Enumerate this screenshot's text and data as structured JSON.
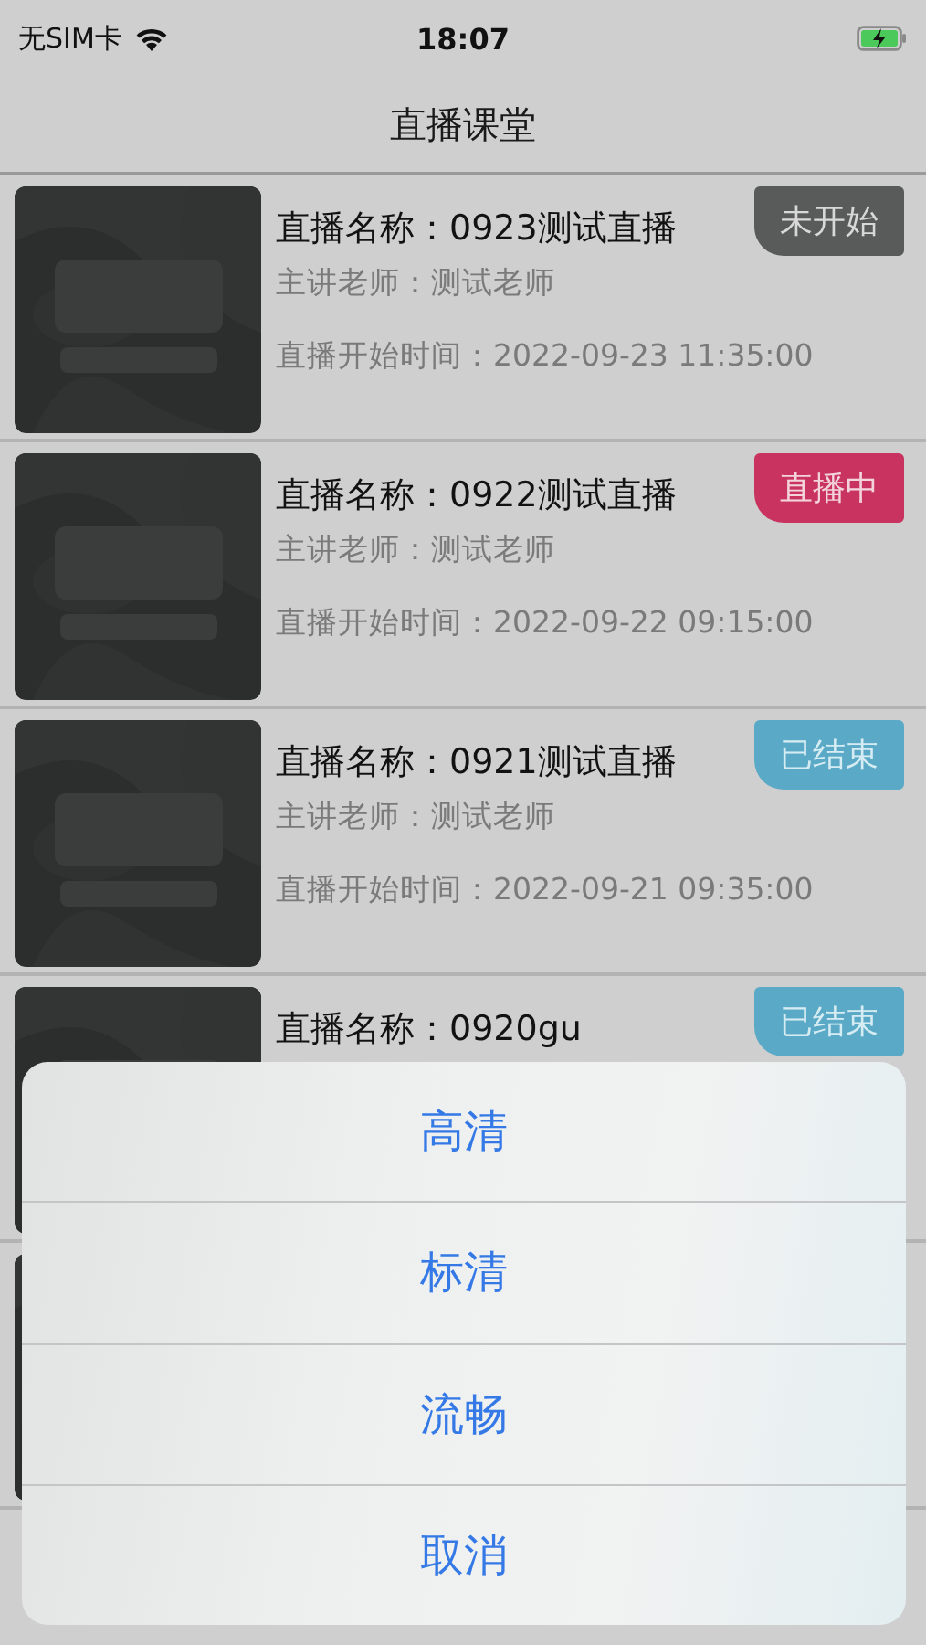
{
  "status_bar": {
    "carrier": "无SIM卡",
    "time": "18:07"
  },
  "nav": {
    "title": "直播课堂"
  },
  "lessons": [
    {
      "kind": "picture",
      "title": "直播名称：0923测试直播",
      "teacher": "主讲老师：测试老师",
      "start_time": "直播开始时间：2022-09-23 11:35:00",
      "status": {
        "kind": "not_started",
        "label": "未开始"
      }
    },
    {
      "kind": "picture",
      "title": "直播名称：0922测试直播",
      "teacher": "主讲老师：测试老师",
      "start_time": "直播开始时间：2022-09-22 09:15:00",
      "status": {
        "kind": "live",
        "label": "直播中"
      }
    },
    {
      "kind": "picture",
      "title": "直播名称：0921测试直播",
      "teacher": "主讲老师：测试老师",
      "start_time": "直播开始时间：2022-09-21 09:35:00",
      "status": {
        "kind": "ended",
        "label": "已结束"
      }
    },
    {
      "kind": "picture",
      "title": "直播名称：0920gu",
      "status": {
        "kind": "ended",
        "label": "已结束"
      }
    },
    {
      "kind": "picture"
    }
  ],
  "action_sheet": {
    "options": [
      "高清",
      "标清",
      "流畅"
    ],
    "cancel": "取消"
  }
}
